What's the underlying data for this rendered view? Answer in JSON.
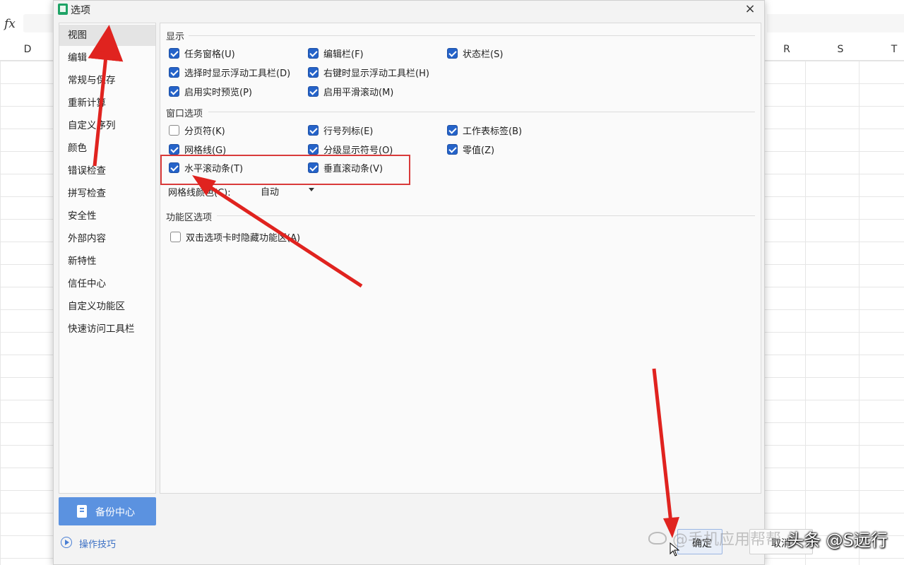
{
  "background": {
    "fx_label": "fx",
    "columns": [
      "D",
      "R",
      "S",
      "T"
    ]
  },
  "dialog": {
    "title": "选项",
    "close_symbol": "×",
    "sidebar": {
      "items": [
        {
          "label": "视图",
          "selected": true
        },
        {
          "label": "编辑"
        },
        {
          "label": "常规与保存"
        },
        {
          "label": "重新计算"
        },
        {
          "label": "自定义序列"
        },
        {
          "label": "颜色"
        },
        {
          "label": "错误检查"
        },
        {
          "label": "拼写检查"
        },
        {
          "label": "安全性"
        },
        {
          "label": "外部内容"
        },
        {
          "label": "新特性"
        },
        {
          "label": "信任中心"
        },
        {
          "label": "自定义功能区"
        },
        {
          "label": "快速访问工具栏"
        }
      ]
    },
    "backup_label": "备份中心",
    "tips_label": "操作技巧",
    "sections": {
      "display": {
        "heading": "显示",
        "options": [
          {
            "label": "任务窗格(U)",
            "checked": true
          },
          {
            "label": "编辑栏(F)",
            "checked": true
          },
          {
            "label": "状态栏(S)",
            "checked": true
          },
          {
            "label": "选择时显示浮动工具栏(D)",
            "checked": true
          },
          {
            "label": "右键时显示浮动工具栏(H)",
            "checked": true
          },
          {
            "label": "启用实时预览(P)",
            "checked": true
          },
          {
            "label": "启用平滑滚动(M)",
            "checked": true
          }
        ]
      },
      "window": {
        "heading": "窗口选项",
        "options": [
          {
            "label": "分页符(K)",
            "checked": false
          },
          {
            "label": "行号列标(E)",
            "checked": true
          },
          {
            "label": "工作表标签(B)",
            "checked": true
          },
          {
            "label": "网格线(G)",
            "checked": true
          },
          {
            "label": "分级显示符号(O)",
            "checked": true
          },
          {
            "label": "零值(Z)",
            "checked": true
          },
          {
            "label": "水平滚动条(T)",
            "checked": true
          },
          {
            "label": "垂直滚动条(V)",
            "checked": true
          }
        ],
        "gridline_color_label": "网格线颜色(C):",
        "gridline_color_value": "自动"
      },
      "ribbon": {
        "heading": "功能区选项",
        "options": [
          {
            "label": "双击选项卡时隐藏功能区(A)",
            "checked": false
          }
        ]
      }
    },
    "ok_label": "确定",
    "cancel_label": "取消"
  },
  "watermark": {
    "faint_text": "@手机应用帮帮",
    "main_text": "头条 @S远行"
  },
  "colors": {
    "accent": "#2563c9",
    "annotation_red": "#d93a3a",
    "backup_button": "#5b92e0"
  }
}
